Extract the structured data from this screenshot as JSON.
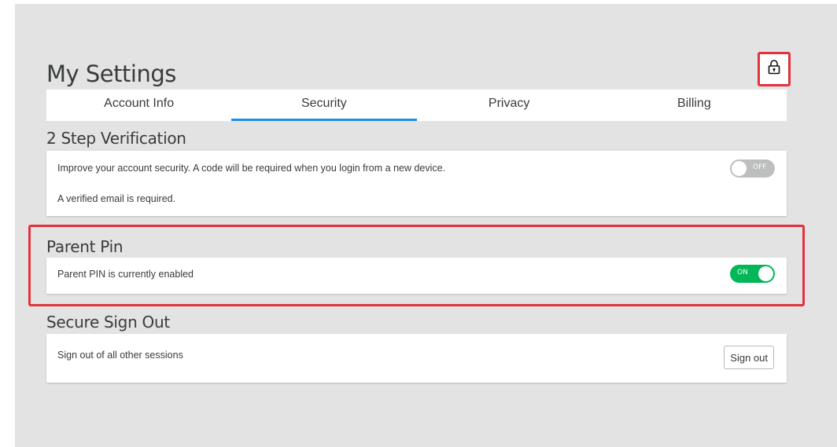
{
  "page": {
    "title": "My Settings"
  },
  "header": {
    "lock_icon": "padlock-icon"
  },
  "tabs": [
    {
      "label": "Account Info",
      "active": false
    },
    {
      "label": "Security",
      "active": true
    },
    {
      "label": "Privacy",
      "active": false
    },
    {
      "label": "Billing",
      "active": false
    }
  ],
  "sections": {
    "two_step": {
      "title": "2 Step Verification",
      "description": "Improve your account security. A code will be required when you login from a new device.",
      "note": "A verified email is required.",
      "toggle_label": "OFF",
      "enabled": false
    },
    "parent_pin": {
      "title": "Parent Pin",
      "description": "Parent PIN is currently enabled",
      "toggle_label": "ON",
      "enabled": true
    },
    "secure_sign_out": {
      "title": "Secure Sign Out",
      "description": "Sign out of all other sessions",
      "button_label": "Sign out"
    }
  },
  "colors": {
    "background": "#e3e3e3",
    "card": "#ffffff",
    "text": "#393b3d",
    "tab_active_underline": "#1b8ee8",
    "toggle_on": "#02b757",
    "toggle_off": "#bdbebe",
    "annotation_highlight": "#e0333d"
  }
}
